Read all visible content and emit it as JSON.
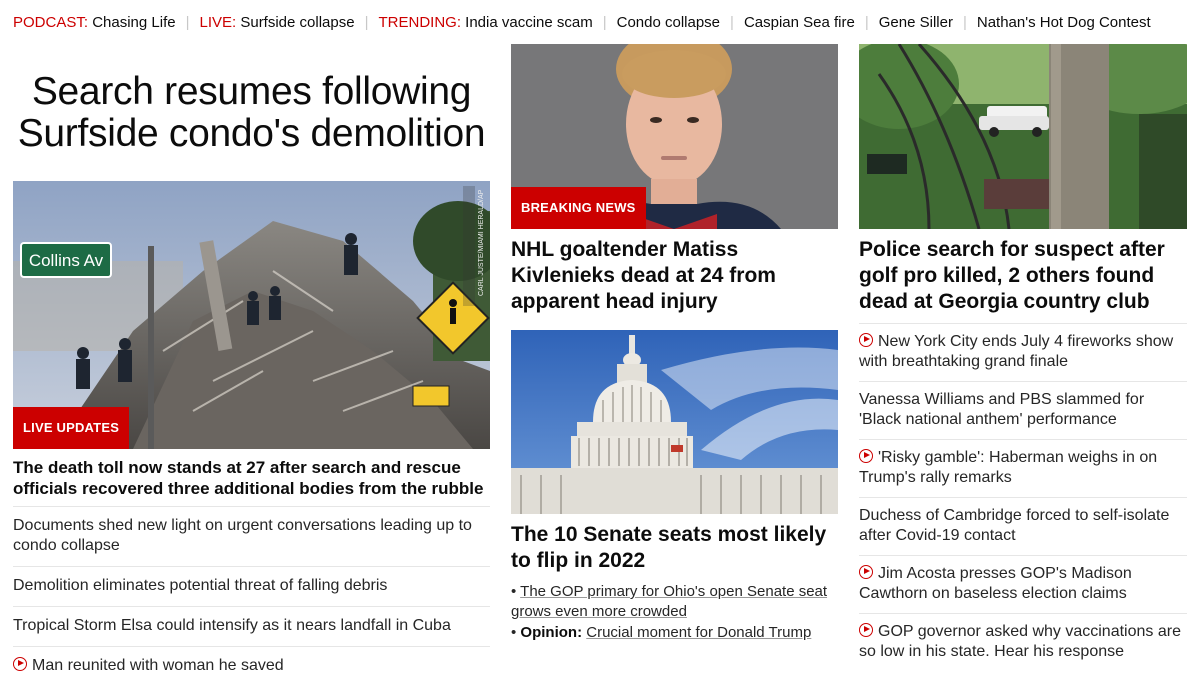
{
  "topbar": {
    "podcast_label": "PODCAST:",
    "podcast_item": "Chasing Life",
    "live_label": "LIVE:",
    "live_item": "Surfside collapse",
    "trending_label": "TRENDING:",
    "trending": [
      "India vaccine scam",
      "Condo collapse",
      "Caspian Sea fire",
      "Gene Siller",
      "Nathan's Hot Dog Contest"
    ]
  },
  "col1": {
    "big_title": "Search resumes following Surfside condo's demolition",
    "image_badge": "LIVE UPDATES",
    "sign_text": "Collins Av",
    "photo_credit": "CARL JUSTE/MIAMI HERALD/AP",
    "headline": "The death toll now stands at 27 after search and rescue officials recovered three additional bodies from the rubble",
    "links": [
      {
        "text": "Documents shed new light on urgent conversations leading up to condo collapse",
        "video": false
      },
      {
        "text": "Demolition eliminates potential threat of falling debris",
        "video": false
      },
      {
        "text": "Tropical Storm Elsa could intensify as it nears landfall in Cuba",
        "video": false
      },
      {
        "text": "Man reunited with woman he saved",
        "video": true
      }
    ]
  },
  "col2": {
    "story1": {
      "badge": "BREAKING NEWS",
      "headline": "NHL goaltender Matiss Kivlenieks dead at 24 from apparent head injury"
    },
    "story2": {
      "headline": "The 10 Senate seats most likely to flip in 2022",
      "bullet1": "The GOP primary for Ohio's open Senate seat grows even more crowded",
      "bullet2_label": "Opinion:",
      "bullet2": "Crucial moment for Donald Trump"
    }
  },
  "col3": {
    "headline": "Police search for suspect after golf pro killed, 2 others found dead at Georgia country club",
    "links": [
      {
        "text": "New York City ends July 4 fireworks show with breathtaking grand finale",
        "video": true
      },
      {
        "text": "Vanessa Williams and PBS slammed for 'Black national anthem' performance",
        "video": false
      },
      {
        "text": "'Risky gamble': Haberman weighs in on Trump's rally remarks",
        "video": true
      },
      {
        "text": "Duchess of Cambridge forced to self-isolate after Covid-19 contact",
        "video": false
      },
      {
        "text": "Jim Acosta presses GOP's Madison Cawthorn on baseless election claims",
        "video": true
      },
      {
        "text": "GOP governor asked why vaccinations are so low in his state. Hear his response",
        "video": true
      }
    ]
  },
  "colors": {
    "accent": "#cc0000",
    "text": "#0c0c0c",
    "divider": "#e6e6e6"
  }
}
